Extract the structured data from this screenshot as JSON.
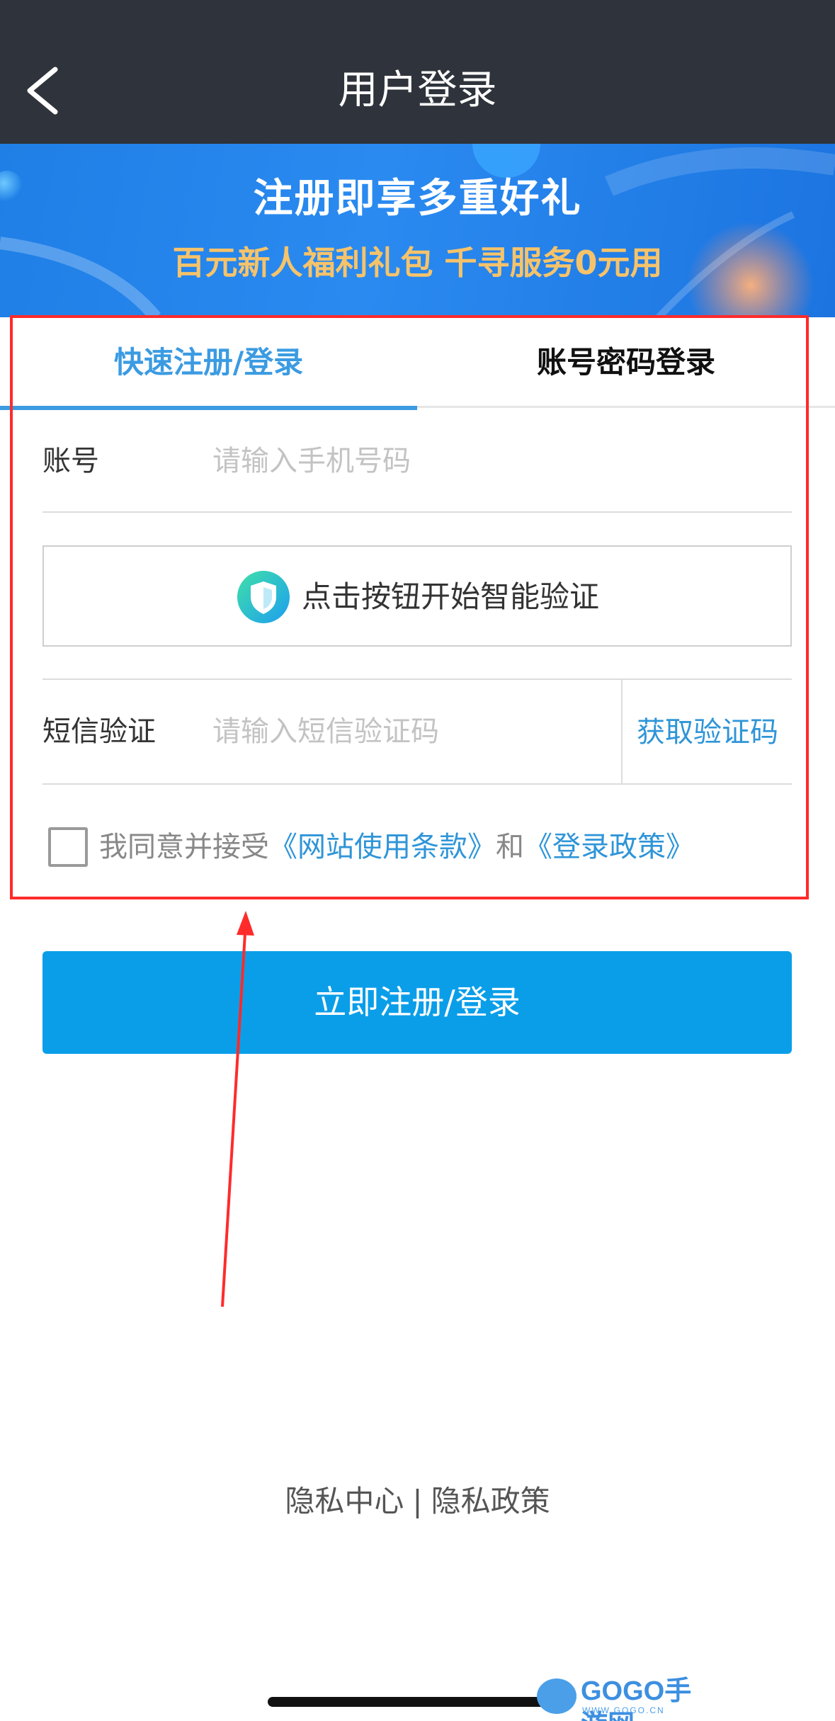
{
  "header": {
    "title": "用户登录",
    "back_icon": "chevron-left-icon"
  },
  "banner": {
    "title": "注册即享多重好礼",
    "subtitle": "百元新人福利礼包  千寻服务0元用"
  },
  "tabs": [
    {
      "label": "快速注册/登录",
      "active": true
    },
    {
      "label": "账号密码登录",
      "active": false
    }
  ],
  "account": {
    "label": "账号",
    "placeholder": "请输入手机号码",
    "value": ""
  },
  "verify": {
    "icon": "shield-icon",
    "label": "点击按钮开始智能验证"
  },
  "sms": {
    "label": "短信验证",
    "placeholder": "请输入短信验证码",
    "value": "",
    "get_code_label": "获取验证码"
  },
  "agreement": {
    "checked": false,
    "prefix": "我同意并接受",
    "terms_link": "《网站使用条款》",
    "conjunction": "和",
    "policy_link": "《登录政策》"
  },
  "submit": {
    "label": "立即注册/登录"
  },
  "footer": {
    "privacy_center": "隐私中心",
    "separator": "|",
    "privacy_policy": "隐私政策"
  },
  "watermark": {
    "text": "GOGO手游网",
    "url": "WWW.GOGO.CN"
  },
  "colors": {
    "header_bg": "#2f333b",
    "accent_blue": "#3b9be2",
    "button_blue": "#0a9ee9",
    "banner_gold": "#f6c36a",
    "annotation_red": "#ff2b2b"
  }
}
